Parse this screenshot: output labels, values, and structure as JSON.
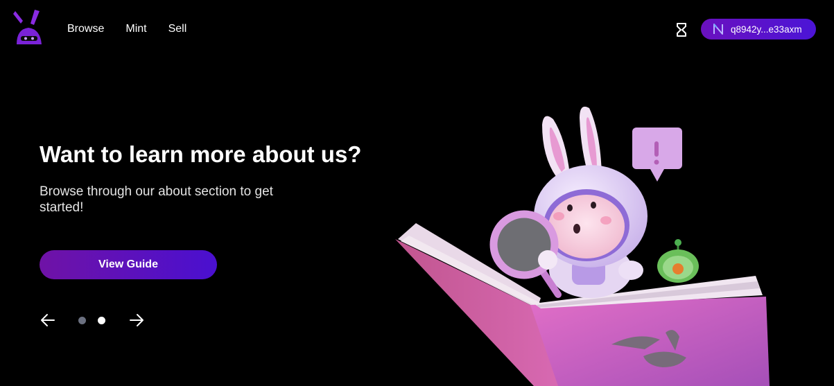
{
  "header": {
    "logo_icon": "bunny-logo-icon",
    "nav": [
      {
        "label": "Browse"
      },
      {
        "label": "Mint"
      },
      {
        "label": "Sell"
      }
    ],
    "activity_icon": "hourglass-icon",
    "wallet": {
      "icon": "near-protocol-icon",
      "address": "q8942y...e33axm"
    }
  },
  "hero": {
    "title": "Want to learn more about us?",
    "subtitle": "Browse through our about section to get started!",
    "cta_label": "View Guide",
    "illustration_icon": "astronaut-bunny-on-book-illustration"
  },
  "carousel": {
    "prev_icon": "arrow-left-icon",
    "next_icon": "arrow-right-icon",
    "slide_count": 2,
    "active_slide": 2
  },
  "colors": {
    "background": "#000000",
    "accent_start": "#6f12a6",
    "accent_end": "#4a10d0",
    "logo": "#8a2be2",
    "dot_inactive": "#6b7080",
    "dot_active": "#ffffff"
  }
}
